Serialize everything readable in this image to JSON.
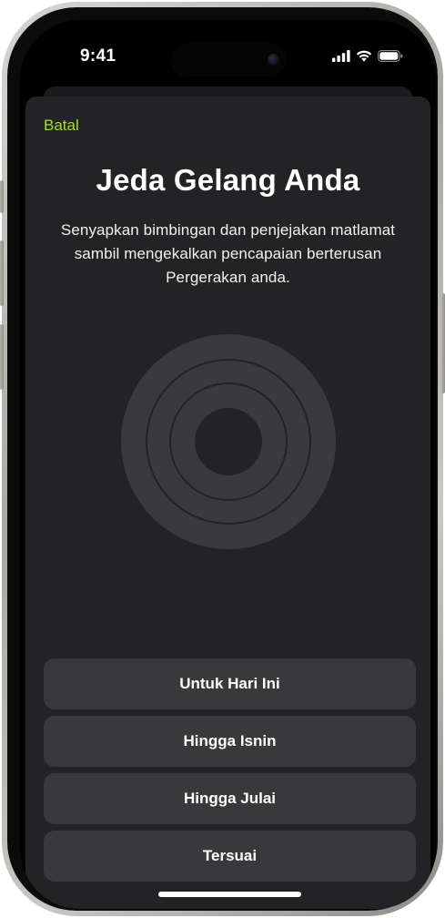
{
  "status_bar": {
    "time": "9:41",
    "icons": [
      "cellular-signal-icon",
      "wifi-icon",
      "battery-icon"
    ]
  },
  "sheet": {
    "cancel_label": "Batal",
    "title": "Jeda Gelang Anda",
    "description": "Senyapkan bimbingan dan penjejakan matlamat sambil mengekalkan pencapaian berterusan Pergerakan anda.",
    "options": [
      {
        "label": "Untuk Hari Ini"
      },
      {
        "label": "Hingga Isnin"
      },
      {
        "label": "Hingga Julai"
      },
      {
        "label": "Tersuai"
      }
    ]
  },
  "colors": {
    "accent": "#a3df2a",
    "sheet_background": "#232325",
    "button_background": "#39393c",
    "rings": "#3a3a3c"
  }
}
